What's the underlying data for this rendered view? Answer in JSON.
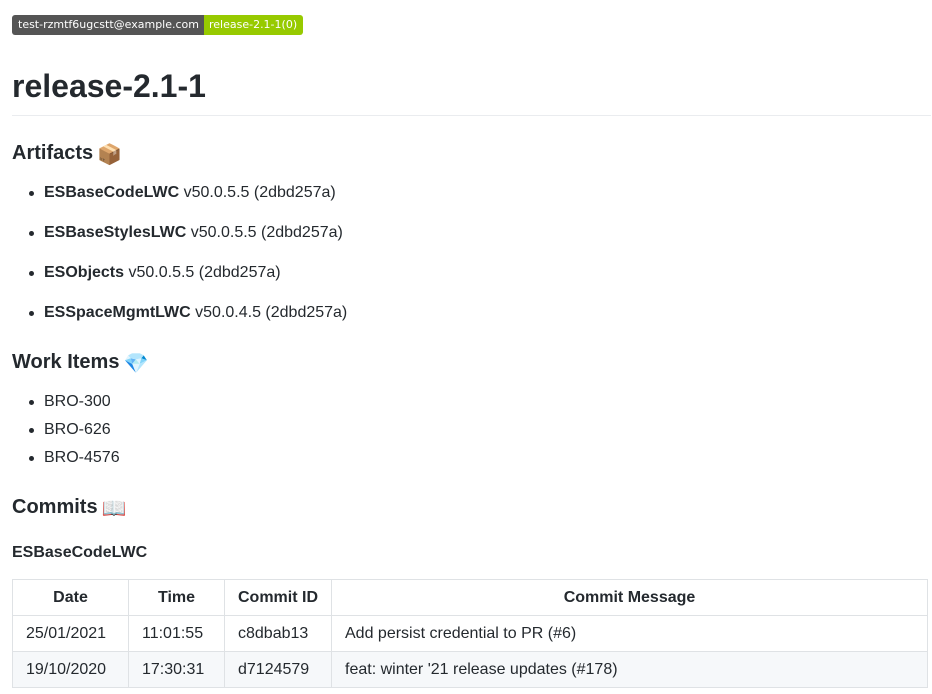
{
  "badge": {
    "left": "test-rzmtf6ugcstt@example.com",
    "right": "release-2.1-1(0)"
  },
  "title": "release-2.1-1",
  "artifacts_section": {
    "heading": "Artifacts",
    "emoji": "📦",
    "items": [
      {
        "name": "ESBaseCodeLWC",
        "detail": "v50.0.5.5 (2dbd257a)"
      },
      {
        "name": "ESBaseStylesLWC",
        "detail": "v50.0.5.5 (2dbd257a)"
      },
      {
        "name": "ESObjects",
        "detail": "v50.0.5.5 (2dbd257a)"
      },
      {
        "name": "ESSpaceMgmtLWC",
        "detail": "v50.0.4.5 (2dbd257a)"
      }
    ]
  },
  "work_items_section": {
    "heading": "Work Items",
    "emoji": "💎",
    "items": [
      "BRO-300",
      "BRO-626",
      "BRO-4576"
    ]
  },
  "commits_section": {
    "heading": "Commits",
    "emoji": "📖",
    "subheading": "ESBaseCodeLWC",
    "columns": [
      "Date",
      "Time",
      "Commit ID",
      "Commit Message"
    ],
    "rows": [
      [
        "25/01/2021",
        "11:01:55",
        "c8dbab13",
        "Add persist credential to PR (#6)"
      ],
      [
        "19/10/2020",
        "17:30:31",
        "d7124579",
        "feat: winter '21 release updates (#178)"
      ]
    ]
  }
}
